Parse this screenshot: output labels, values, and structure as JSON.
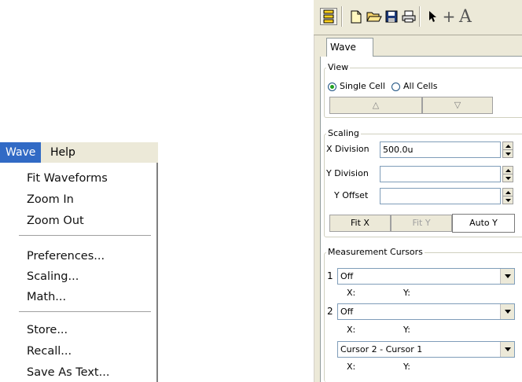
{
  "menu": {
    "bar": {
      "wave": "Wave",
      "help": "Help"
    },
    "items": {
      "fit_waveforms": "Fit Waveforms",
      "zoom_in": "Zoom In",
      "zoom_out": "Zoom Out",
      "preferences": "Preferences...",
      "scaling": "Scaling...",
      "math": "Math...",
      "store": "Store...",
      "recall": "Recall...",
      "save_as_text": "Save As Text..."
    }
  },
  "toolbar": {
    "buttons": [
      "cell-view-icon",
      "new-document-icon",
      "open-folder-icon",
      "save-disk-icon",
      "print-icon",
      "pointer-arrow-icon",
      "crosshair-icon",
      "text-a-icon"
    ],
    "text_tool_glyph": "A",
    "crosshair_glyph": "+"
  },
  "tabs": {
    "wave": "Wave"
  },
  "view": {
    "title": "View",
    "single_cell": "Single Cell",
    "all_cells": "All Cells",
    "selected": "single_cell",
    "up_glyph": "△",
    "down_glyph": "▽"
  },
  "scaling": {
    "title": "Scaling",
    "x_division_label": "X Division",
    "x_division_value": "500.0u",
    "y_division_label": "Y Division",
    "y_division_value": "",
    "y_offset_label": "Y Offset",
    "y_offset_value": "",
    "fit_x": "Fit X",
    "fit_y": "Fit Y",
    "auto_y": "Auto Y"
  },
  "cursors": {
    "title": "Measurement Cursors",
    "c1_num": "1",
    "c1_value": "Off",
    "c1_x": "X:",
    "c1_y": "Y:",
    "c2_num": "2",
    "c2_value": "Off",
    "c2_x": "X:",
    "c2_y": "Y:",
    "diff_value": "Cursor 2 - Cursor 1",
    "diff_x": "X:",
    "diff_y": "Y:"
  },
  "colors": {
    "menu_highlight": "#316ac5",
    "panel_bg": "#ece9d8",
    "radio_dot": "#21a121"
  }
}
